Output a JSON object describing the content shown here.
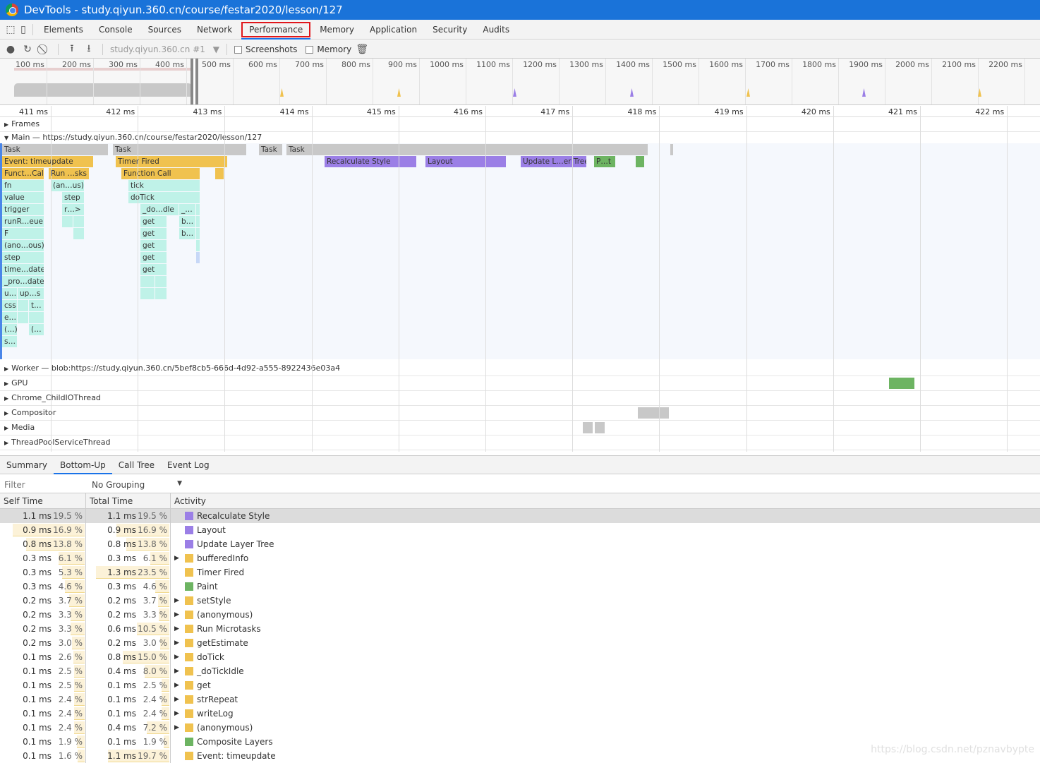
{
  "window": {
    "title": "DevTools - study.qiyun.360.cn/course/festar2020/lesson/127"
  },
  "tabs": [
    "Elements",
    "Console",
    "Sources",
    "Network",
    "Performance",
    "Memory",
    "Application",
    "Security",
    "Audits"
  ],
  "selected_tab": "Performance",
  "toolbar": {
    "target": "study.qiyun.360.cn #1",
    "screenshots_label": "Screenshots",
    "memory_label": "Memory",
    "screenshots_checked": false,
    "memory_checked": false
  },
  "overview": {
    "ticks": [
      "100 ms",
      "200 ms",
      "300 ms",
      "400 ms",
      "500 ms",
      "600 ms",
      "700 ms",
      "800 ms",
      "900 ms",
      "1000 ms",
      "1100 ms",
      "1200 ms",
      "1300 ms",
      "1400 ms",
      "1500 ms",
      "1600 ms",
      "1700 ms",
      "1800 ms",
      "1900 ms",
      "2000 ms",
      "2100 ms",
      "2200 ms"
    ]
  },
  "ruler": {
    "ticks": [
      "411 ms",
      "412 ms",
      "413 ms",
      "414 ms",
      "415 ms",
      "416 ms",
      "417 ms",
      "418 ms",
      "419 ms",
      "420 ms",
      "421 ms",
      "422 ms"
    ]
  },
  "tracks": {
    "frames": "Frames",
    "main": "Main — https://study.qiyun.360.cn/course/festar2020/lesson/127",
    "worker": "Worker — blob:https://study.qiyun.360.cn/5bef8cb5-666d-4d92-a555-8922436e03a4",
    "gpu": "GPU",
    "io": "Chrome_ChildIOThread",
    "compositor": "Compositor",
    "media": "Media",
    "threadpool": "ThreadPoolServiceThread"
  },
  "flame": {
    "labels": [
      "Task",
      "Task",
      "Task",
      "Task",
      "Event: timeupdate",
      "Timer Fired",
      "Recalculate Style",
      "Layout",
      "Update L…er Tree",
      "P…t",
      "Funct…Call",
      "Run …sks",
      "Function Call",
      "fn",
      "(an…us)",
      "tick",
      "value",
      "step",
      "doTick",
      "trigger",
      "r…>",
      "_do…dle",
      "_…",
      "runR…eue",
      "get",
      "b…",
      "F",
      "get",
      "b…",
      "(ano…ous)",
      "get",
      "step",
      "get",
      "time…date",
      "get",
      "_pro…date",
      "u…",
      "up…s",
      "css",
      "t…",
      "e…",
      "(…)",
      "(…",
      "s…"
    ],
    "colors": {
      "task": "#c8c8c8",
      "script": "#f0c24f",
      "render": "#9b7fe6",
      "paint": "#6db462",
      "js": "#bff2e8"
    }
  },
  "bottom": {
    "tabs": [
      "Summary",
      "Bottom-Up",
      "Call Tree",
      "Event Log"
    ],
    "selected": "Bottom-Up",
    "filter_placeholder": "Filter",
    "grouping": "No Grouping",
    "headers": [
      "Self Time",
      "Total Time",
      "Activity"
    ],
    "rows": [
      {
        "self": "1.1 ms",
        "self_pct": "19.5 %",
        "total": "1.1 ms",
        "total_pct": "19.5 %",
        "activity": "Recalculate Style",
        "color": "#9b7fe6",
        "expandable": false,
        "selected": true
      },
      {
        "self": "0.9 ms",
        "self_pct": "16.9 %",
        "total": "0.9 ms",
        "total_pct": "16.9 %",
        "activity": "Layout",
        "color": "#9b7fe6",
        "expandable": false
      },
      {
        "self": "0.8 ms",
        "self_pct": "13.8 %",
        "total": "0.8 ms",
        "total_pct": "13.8 %",
        "activity": "Update Layer Tree",
        "color": "#9b7fe6",
        "expandable": false
      },
      {
        "self": "0.3 ms",
        "self_pct": "6.1 %",
        "total": "0.3 ms",
        "total_pct": "6.1 %",
        "activity": "bufferedInfo",
        "color": "#f0c24f",
        "expandable": true
      },
      {
        "self": "0.3 ms",
        "self_pct": "5.3 %",
        "total": "1.3 ms",
        "total_pct": "23.5 %",
        "activity": "Timer Fired",
        "color": "#f0c24f",
        "expandable": false
      },
      {
        "self": "0.3 ms",
        "self_pct": "4.6 %",
        "total": "0.3 ms",
        "total_pct": "4.6 %",
        "activity": "Paint",
        "color": "#6db462",
        "expandable": false
      },
      {
        "self": "0.2 ms",
        "self_pct": "3.7 %",
        "total": "0.2 ms",
        "total_pct": "3.7 %",
        "activity": "setStyle",
        "color": "#f0c24f",
        "expandable": true
      },
      {
        "self": "0.2 ms",
        "self_pct": "3.3 %",
        "total": "0.2 ms",
        "total_pct": "3.3 %",
        "activity": "(anonymous)",
        "color": "#f0c24f",
        "expandable": true
      },
      {
        "self": "0.2 ms",
        "self_pct": "3.3 %",
        "total": "0.6 ms",
        "total_pct": "10.5 %",
        "activity": "Run Microtasks",
        "color": "#f0c24f",
        "expandable": true
      },
      {
        "self": "0.2 ms",
        "self_pct": "3.0 %",
        "total": "0.2 ms",
        "total_pct": "3.0 %",
        "activity": "getEstimate",
        "color": "#f0c24f",
        "expandable": true
      },
      {
        "self": "0.1 ms",
        "self_pct": "2.6 %",
        "total": "0.8 ms",
        "total_pct": "15.0 %",
        "activity": "doTick",
        "color": "#f0c24f",
        "expandable": true
      },
      {
        "self": "0.1 ms",
        "self_pct": "2.5 %",
        "total": "0.4 ms",
        "total_pct": "8.0 %",
        "activity": "_doTickIdle",
        "color": "#f0c24f",
        "expandable": true
      },
      {
        "self": "0.1 ms",
        "self_pct": "2.5 %",
        "total": "0.1 ms",
        "total_pct": "2.5 %",
        "activity": "get",
        "color": "#f0c24f",
        "expandable": true
      },
      {
        "self": "0.1 ms",
        "self_pct": "2.4 %",
        "total": "0.1 ms",
        "total_pct": "2.4 %",
        "activity": "strRepeat",
        "color": "#f0c24f",
        "expandable": true
      },
      {
        "self": "0.1 ms",
        "self_pct": "2.4 %",
        "total": "0.1 ms",
        "total_pct": "2.4 %",
        "activity": "writeLog",
        "color": "#f0c24f",
        "expandable": true
      },
      {
        "self": "0.1 ms",
        "self_pct": "2.4 %",
        "total": "0.4 ms",
        "total_pct": "7.2 %",
        "activity": "(anonymous)",
        "color": "#f0c24f",
        "expandable": true
      },
      {
        "self": "0.1 ms",
        "self_pct": "1.9 %",
        "total": "0.1 ms",
        "total_pct": "1.9 %",
        "activity": "Composite Layers",
        "color": "#6db462",
        "expandable": false
      },
      {
        "self": "0.1 ms",
        "self_pct": "1.6 %",
        "total": "1.1 ms",
        "total_pct": "19.7 %",
        "activity": "Event: timeupdate",
        "color": "#f0c24f",
        "expandable": false
      }
    ]
  },
  "watermark": "https://blog.csdn.net/pznavbypte"
}
